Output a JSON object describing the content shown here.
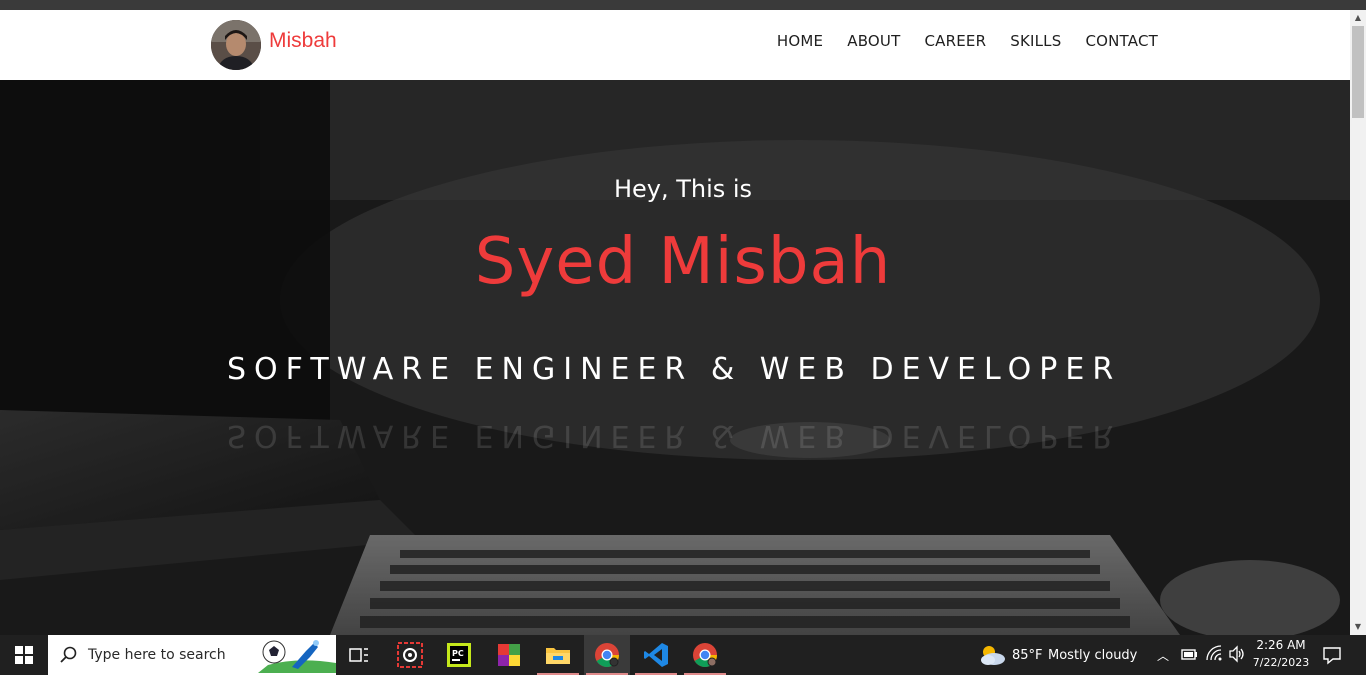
{
  "navbar": {
    "brand": "Misbah",
    "links": [
      "HOME",
      "ABOUT",
      "CAREER",
      "SKILLS",
      "CONTACT"
    ]
  },
  "hero": {
    "greeting": "Hey, This is",
    "name": "Syed Misbah",
    "tagline": "SOFTWARE ENGINEER & WEB DEVELOPER"
  },
  "colors": {
    "accent": "#ee3b3b",
    "navbar_bg": "#ffffff",
    "taskbar_bg": "#202020"
  },
  "taskbar": {
    "search_placeholder": "Type here to search",
    "icons": [
      "task-view-icon",
      "screen-capture-icon",
      "pycharm-icon",
      "winrar-icon",
      "file-explorer-icon",
      "chrome-icon",
      "vscode-icon",
      "chrome-profile-icon"
    ],
    "weather_temp": "85°F",
    "weather_text": "Mostly cloudy",
    "time": "2:26 AM",
    "date": "7/22/2023"
  }
}
